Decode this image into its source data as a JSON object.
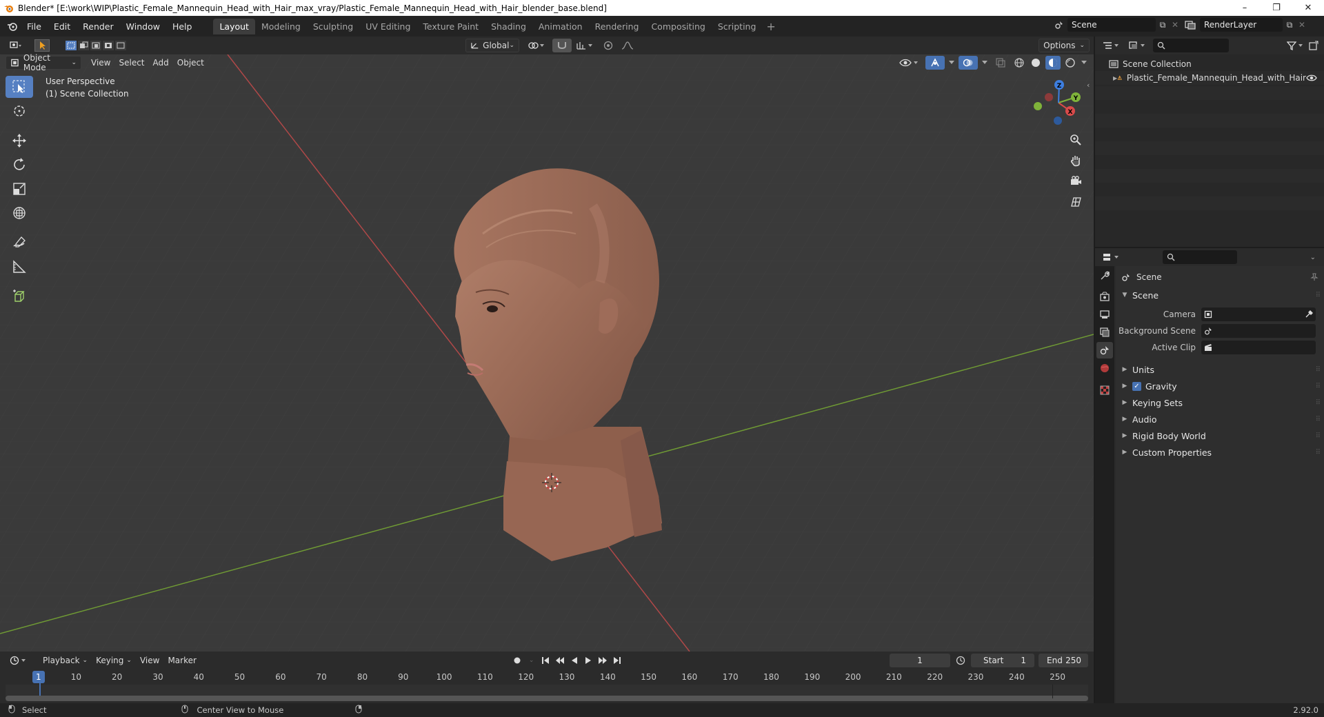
{
  "window": {
    "title": "Blender* [E:\\work\\WIP\\Plastic_Female_Mannequin_Head_with_Hair_max_vray/Plastic_Female_Mannequin_Head_with_Hair_blender_base.blend]",
    "controls": [
      "–",
      "❐",
      "✕"
    ]
  },
  "menubar": {
    "items": [
      "File",
      "Edit",
      "Render",
      "Window",
      "Help"
    ],
    "workspaces": [
      "Layout",
      "Modeling",
      "Sculpting",
      "UV Editing",
      "Texture Paint",
      "Shading",
      "Animation",
      "Rendering",
      "Compositing",
      "Scripting"
    ],
    "active_workspace": "Layout",
    "add_workspace": "+",
    "scene_name": "Scene",
    "view_layer": "RenderLayer"
  },
  "viewport": {
    "mode": "Object Mode",
    "menus": [
      "View",
      "Select",
      "Add",
      "Object"
    ],
    "transform_orientation": "Global",
    "options_label": "Options",
    "overlay_line1": "User Perspective",
    "overlay_line2": "(1) Scene Collection",
    "gizmo_axes": {
      "x": "X",
      "y": "Y",
      "z": "Z"
    }
  },
  "timeline": {
    "menus": [
      "Playback",
      "Keying",
      "View",
      "Marker"
    ],
    "current_frame": "1",
    "start_label": "Start",
    "start_value": "1",
    "end_label": "End",
    "end_value": "250",
    "ruler_marks": [
      "1",
      "10",
      "20",
      "30",
      "40",
      "50",
      "60",
      "70",
      "80",
      "90",
      "100",
      "110",
      "120",
      "130",
      "140",
      "150",
      "160",
      "170",
      "180",
      "190",
      "200",
      "210",
      "220",
      "230",
      "240",
      "250"
    ]
  },
  "statusbar": {
    "select": "Select",
    "center_view": "Center View to Mouse",
    "version": "2.92.0"
  },
  "outliner": {
    "root": "Scene Collection",
    "object": "Plastic_Female_Mannequin_Head_with_Hair"
  },
  "properties": {
    "context": "Scene",
    "section": "Scene",
    "camera_label": "Camera",
    "background_label": "Background Scene",
    "clip_label": "Active Clip",
    "panels": [
      {
        "label": "Units",
        "checkbox": false
      },
      {
        "label": "Gravity",
        "checkbox": true
      },
      {
        "label": "Keying Sets",
        "checkbox": false
      },
      {
        "label": "Audio",
        "checkbox": false
      },
      {
        "label": "Rigid Body World",
        "checkbox": false
      },
      {
        "label": "Custom Properties",
        "checkbox": false
      }
    ]
  },
  "colors": {
    "accent": "#4772b3",
    "x_axis": "#d94a4a",
    "y_axis": "#7fb33a",
    "z_axis": "#3d7ee0",
    "skin": "#a0705c"
  }
}
